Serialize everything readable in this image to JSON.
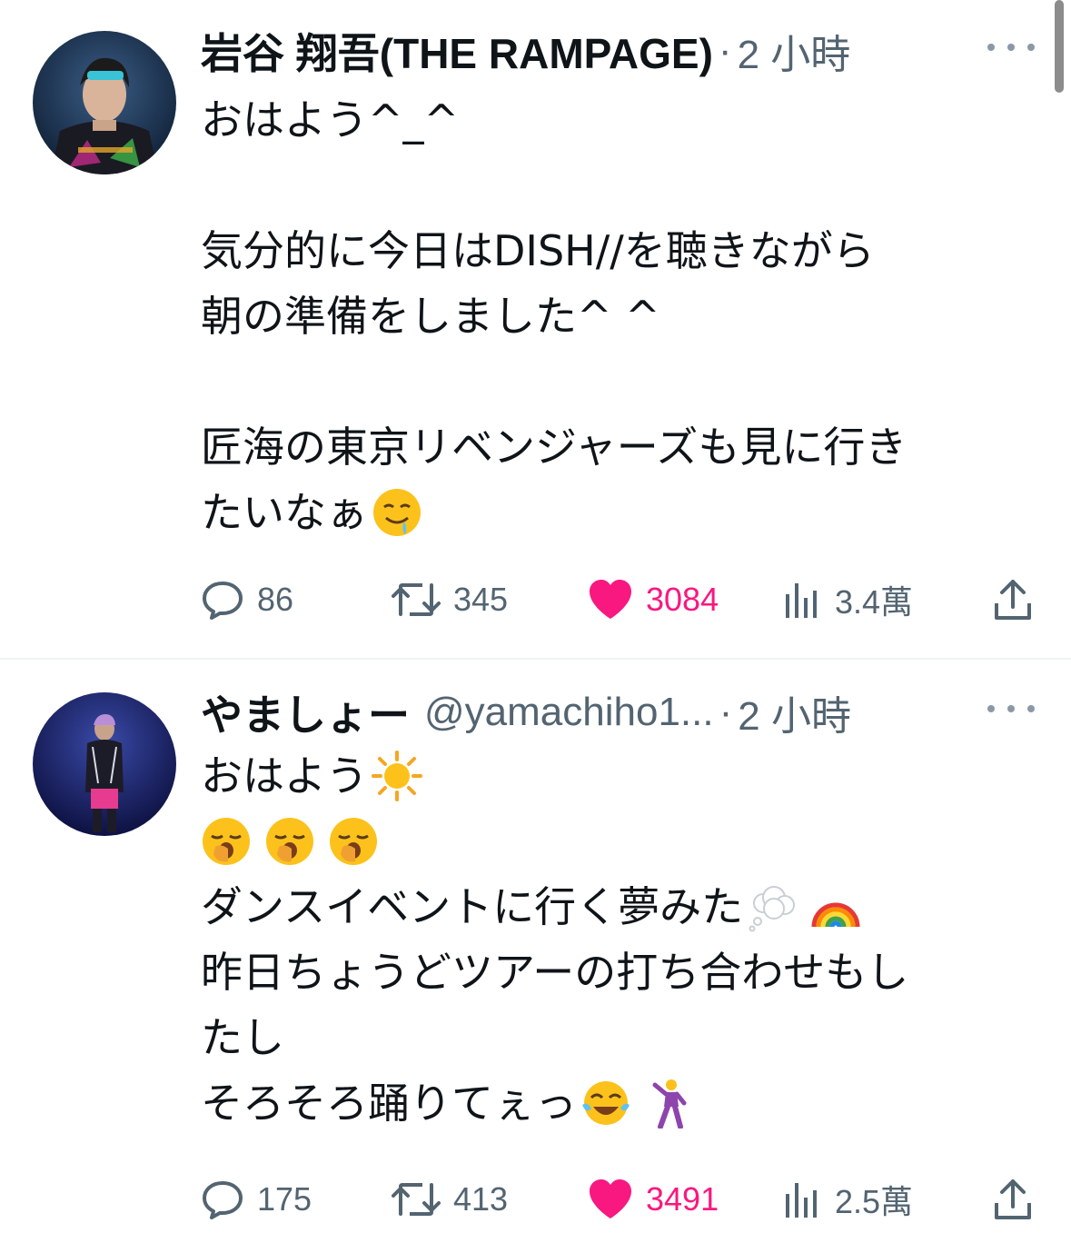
{
  "tweets": [
    {
      "display_name": "岩谷 翔吾(THE RAMPAGE)",
      "handle": "",
      "separator": "·",
      "time": "2 小時",
      "lines": [
        "おはよう^_^",
        "",
        "気分的に今日はDISH//を聴きながら",
        "朝の準備をしました^ ^",
        "",
        "匠海の東京リベンジャーズも見に行き",
        "たいなぁ"
      ],
      "line_emojis": [
        "",
        "",
        "",
        "",
        "",
        "",
        "drooling-face"
      ],
      "stats": {
        "replies": "86",
        "retweets": "345",
        "likes": "3084",
        "views": "3.4萬"
      },
      "liked": true
    },
    {
      "display_name": "やましょー",
      "handle": "@yamachiho1...",
      "separator": "·",
      "time": "2 小時",
      "lines": [
        "おはよう",
        "",
        "ダンスイベントに行く夢みた",
        "昨日ちょうどツアーの打ち合わせもし",
        "たし",
        "そろそろ踊りてぇっ"
      ],
      "line_emojis": [
        "sun-emoji",
        "yawning-face x3",
        "thought-balloon rainbow",
        "",
        "",
        "tears-of-joy man-dancing"
      ],
      "stats": {
        "replies": "175",
        "retweets": "413",
        "likes": "3491",
        "views": "2.5萬"
      },
      "liked": true
    }
  ],
  "icons": [
    "reply-icon",
    "retweet-icon",
    "like-heart-icon",
    "views-icon",
    "share-icon",
    "more-icon"
  ],
  "colors": {
    "text": "#0f1419",
    "secondary": "#536471",
    "like": "#f91880",
    "divider": "#eff3f4"
  }
}
